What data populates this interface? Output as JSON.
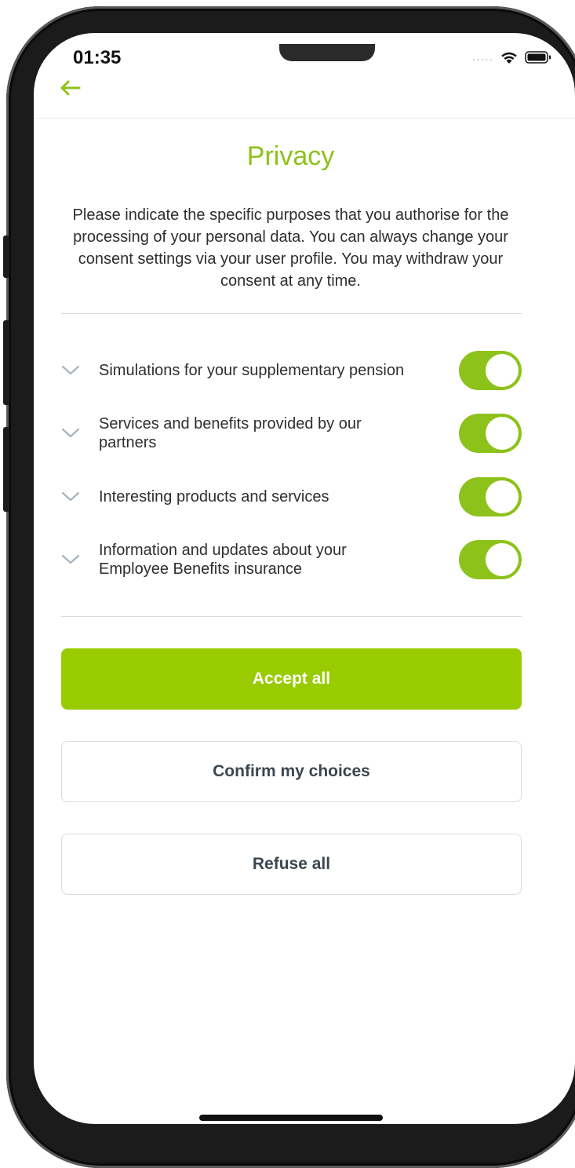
{
  "status_bar": {
    "time": "01:35",
    "signal": "....."
  },
  "header": {
    "back_icon": "arrow-left-icon",
    "title": "Privacy"
  },
  "intro_text": "Please indicate the specific purposes that you authorise for the processing of your personal data. You can always change your consent settings via your user profile. You may withdraw your consent at any time.",
  "consents": [
    {
      "label": "Simulations for your supplementary pension",
      "enabled": true
    },
    {
      "label": "Services and benefits provided by our partners",
      "enabled": true
    },
    {
      "label": "Interesting products and services",
      "enabled": true
    },
    {
      "label": "Information and updates about your Employee Benefits insurance",
      "enabled": true
    }
  ],
  "actions": {
    "accept_all": "Accept all",
    "confirm": "Confirm my choices",
    "refuse_all": "Refuse all"
  },
  "colors": {
    "accent": "#99cc00",
    "title": "#8dc21a",
    "text": "#2e2e2e"
  }
}
